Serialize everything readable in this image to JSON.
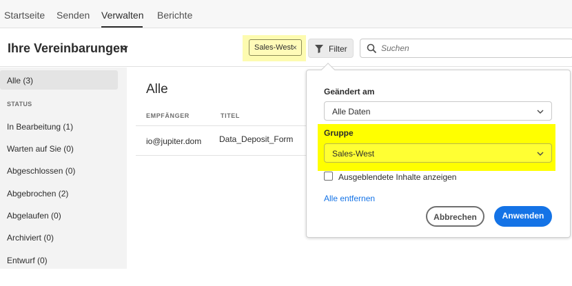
{
  "topnav": {
    "tabs": [
      {
        "label": "Startseite"
      },
      {
        "label": "Senden"
      },
      {
        "label": "Verwalten",
        "active": true
      },
      {
        "label": "Berichte"
      }
    ]
  },
  "header": {
    "title": "Ihre Vereinbarungen",
    "chip_label": "Sales-West",
    "chip_close": "×",
    "filter_label": "Filter",
    "search_placeholder": "Suchen"
  },
  "sidebar": {
    "items": [
      {
        "label": "Alle (3)",
        "active": true
      },
      {
        "label": "In Bearbeitung (1)"
      },
      {
        "label": "Warten auf Sie (0)"
      },
      {
        "label": "Abgeschlossen (0)"
      },
      {
        "label": "Abgebrochen (2)"
      },
      {
        "label": "Abgelaufen (0)"
      },
      {
        "label": "Archiviert (0)"
      },
      {
        "label": "Entwurf (0)"
      }
    ],
    "status_header": "STATUS"
  },
  "main": {
    "title": "Alle",
    "columns": [
      "EMPFÄNGER",
      "TITEL"
    ],
    "rows": [
      {
        "recipient": "io@jupiter.dom",
        "title": "Data_Deposit_Form"
      }
    ]
  },
  "popover": {
    "changed_label": "Geändert am",
    "changed_value": "Alle Daten",
    "group_label": "Gruppe",
    "group_value": "Sales-West",
    "hidden_label": "Ausgeblendete Inhalte anzeigen",
    "hidden_checked": false,
    "clear_label": "Alle entfernen",
    "cancel_label": "Abbrechen",
    "apply_label": "Anwenden"
  },
  "colors": {
    "accent": "#1473e6",
    "highlight": "#ffff00"
  }
}
